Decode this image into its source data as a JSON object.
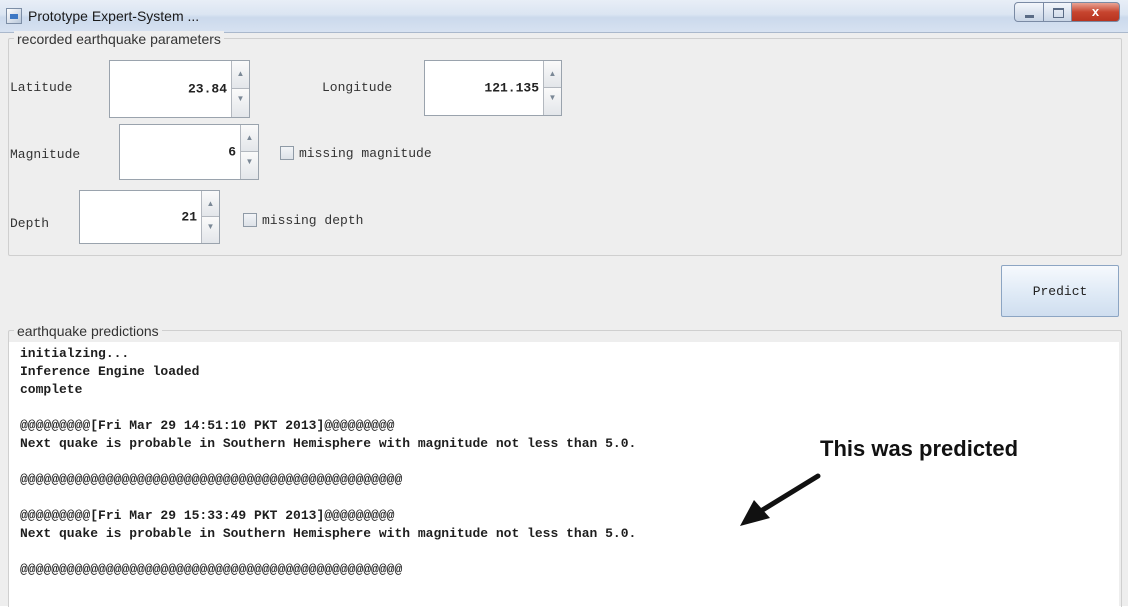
{
  "window": {
    "title": "Prototype Expert-System ...",
    "close_glyph": "x"
  },
  "params_panel": {
    "legend": "recorded earthquake parameters",
    "latitude": {
      "label": "Latitude",
      "value": "23.84"
    },
    "longitude": {
      "label": "Longitude",
      "value": "121.135"
    },
    "magnitude": {
      "label": "Magnitude",
      "value": "6",
      "missing_label": "missing magnitude"
    },
    "depth": {
      "label": "Depth",
      "value": "21",
      "missing_label": "missing depth"
    }
  },
  "predict_button": "Predict",
  "predictions_panel": {
    "legend": "earthquake predictions",
    "lines": [
      "initialzing...",
      "Inference Engine loaded",
      "complete",
      "",
      "@@@@@@@@@[Fri Mar 29 14:51:10 PKT 2013]@@@@@@@@@",
      "Next quake is probable in Southern Hemisphere with magnitude not less than 5.0.",
      "",
      "@@@@@@@@@@@@@@@@@@@@@@@@@@@@@@@@@@@@@@@@@@@@@@@@@",
      "",
      "@@@@@@@@@[Fri Mar 29 15:33:49 PKT 2013]@@@@@@@@@",
      "Next quake is probable in Southern Hemisphere with magnitude not less than 5.0.",
      "",
      "@@@@@@@@@@@@@@@@@@@@@@@@@@@@@@@@@@@@@@@@@@@@@@@@@"
    ]
  },
  "annotation": {
    "text": "This was predicted"
  },
  "icons": {
    "spinner_up": "arrow-up-icon",
    "spinner_down": "arrow-down-icon",
    "callout": "arrow-icon"
  }
}
